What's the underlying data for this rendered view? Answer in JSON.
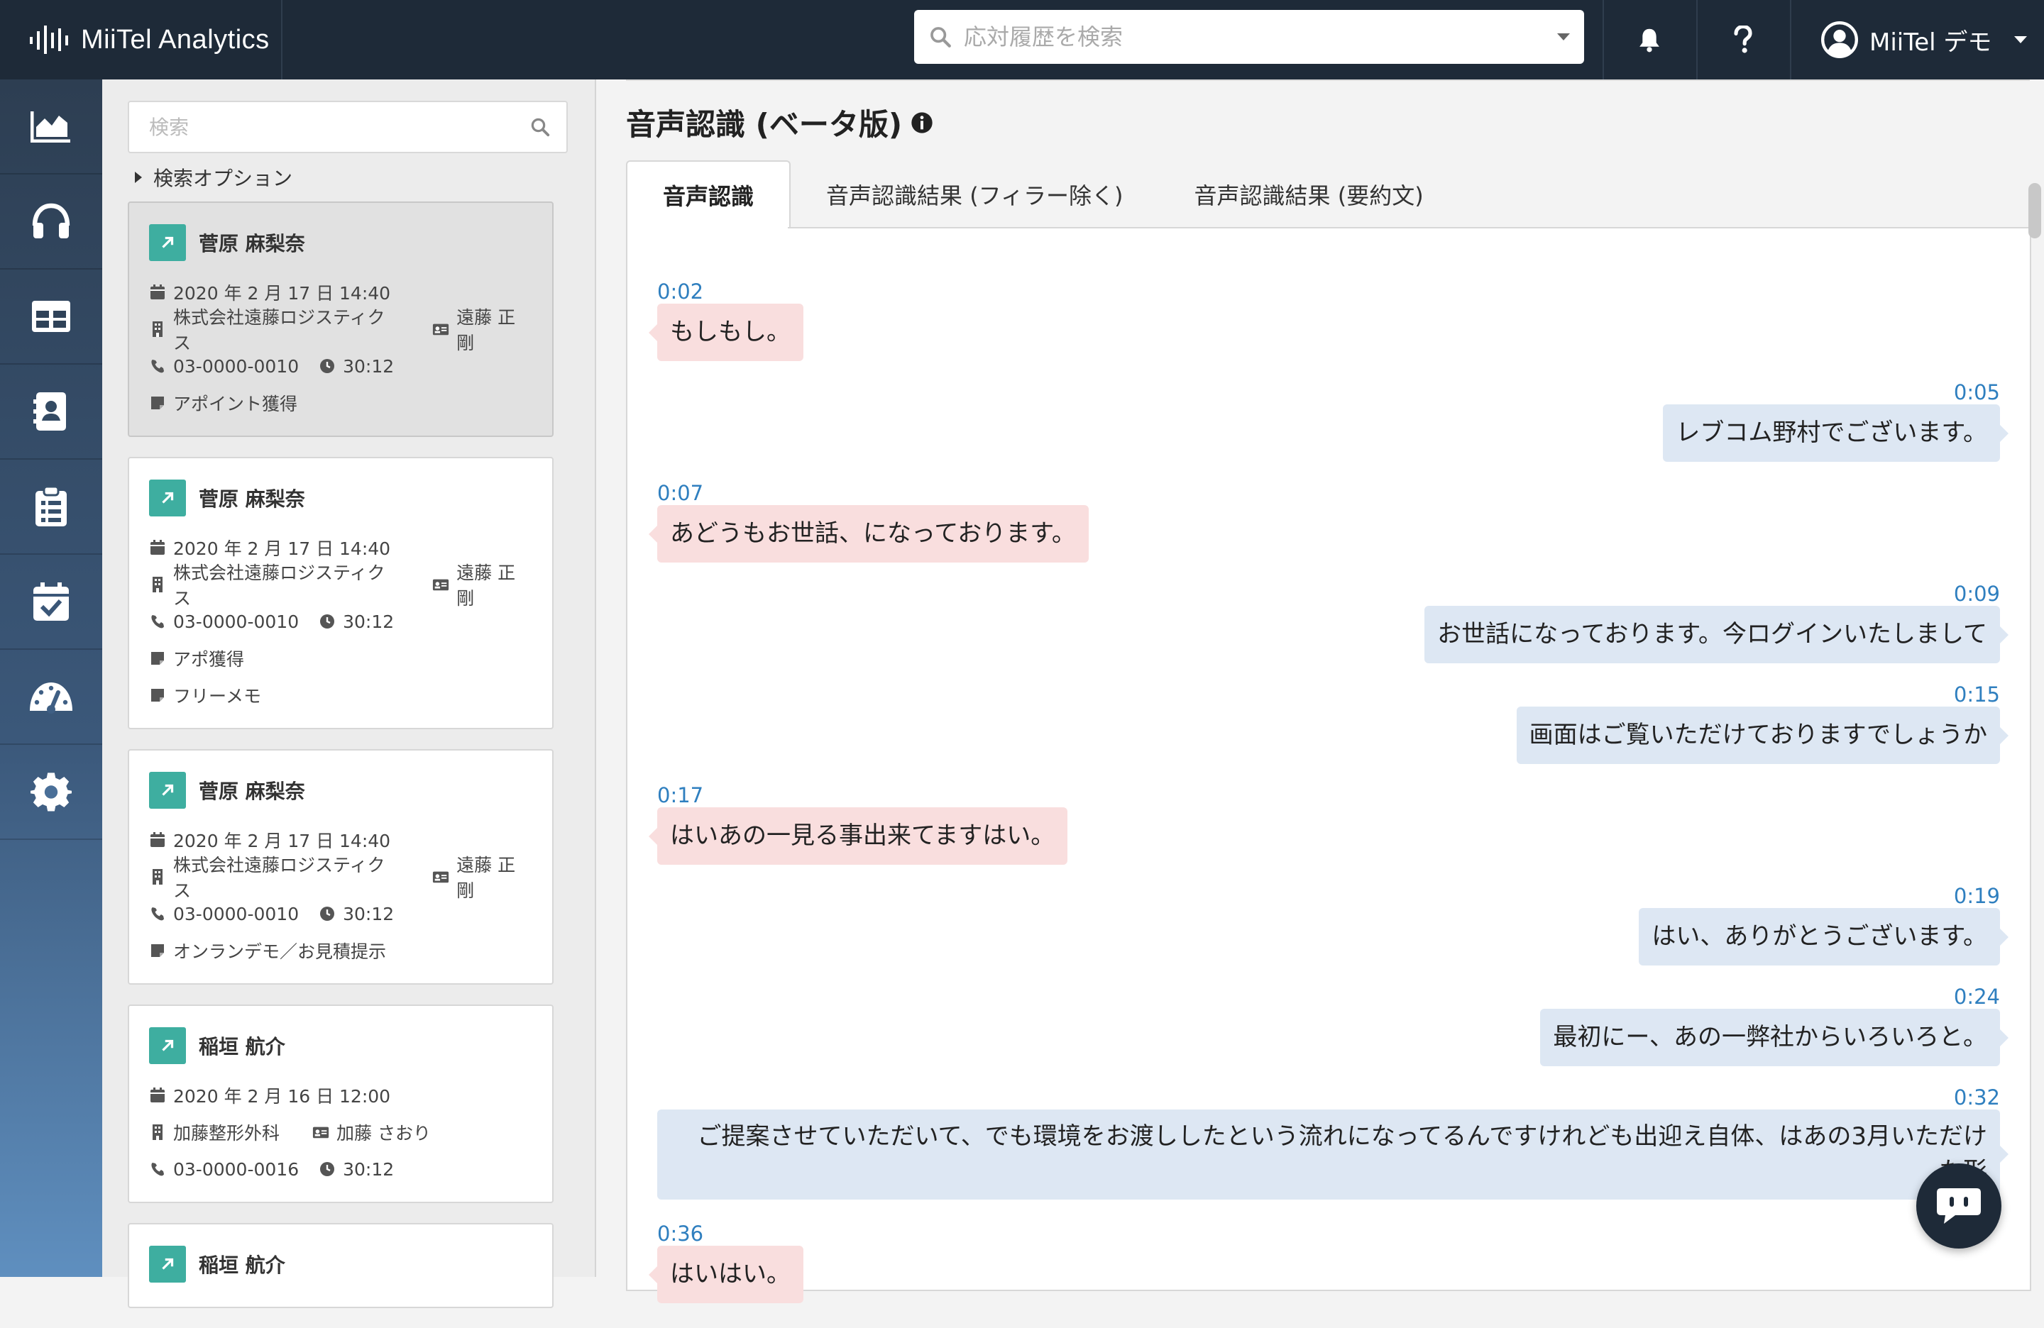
{
  "header": {
    "brand": "MiiTel Analytics",
    "search_placeholder": "応対履歴を検索",
    "user_name": "MiiTel デモ"
  },
  "nav": {
    "items": [
      "chart-icon",
      "headset-icon",
      "table-icon",
      "contact-card-icon",
      "clipboard-list-icon",
      "calendar-check-icon",
      "speedometer-icon",
      "gear-icon"
    ]
  },
  "sidebar": {
    "search_placeholder": "検索",
    "search_options_label": "検索オプション",
    "cards": [
      {
        "name": "菅原 麻梨奈",
        "datetime": "2020 年 2 月 17 日 14:40",
        "company": "株式会社遠藤ロジスティクス",
        "contact": "遠藤 正剛",
        "phone": "03-0000-0010",
        "duration": "30:12",
        "notes": [
          "アポイント獲得"
        ],
        "selected": true
      },
      {
        "name": "菅原 麻梨奈",
        "datetime": "2020 年 2 月 17 日 14:40",
        "company": "株式会社遠藤ロジスティクス",
        "contact": "遠藤 正剛",
        "phone": "03-0000-0010",
        "duration": "30:12",
        "notes": [
          "アポ獲得",
          "フリーメモ"
        ],
        "selected": false
      },
      {
        "name": "菅原 麻梨奈",
        "datetime": "2020 年 2 月 17 日 14:40",
        "company": "株式会社遠藤ロジスティクス",
        "contact": "遠藤 正剛",
        "phone": "03-0000-0010",
        "duration": "30:12",
        "notes": [
          "オンランデモ／お見積提示"
        ],
        "selected": false
      },
      {
        "name": "稲垣 航介",
        "datetime": "2020 年 2 月 16 日 12:00",
        "company": "加藤整形外科",
        "contact": "加藤 さおり",
        "phone": "03-0000-0016",
        "duration": "30:12",
        "notes": [],
        "selected": false
      },
      {
        "name": "稲垣 航介"
      }
    ]
  },
  "main": {
    "title": "音声認識 (ベータ版)",
    "tabs": [
      "音声認識",
      "音声認識結果 (フィラー除く)",
      "音声認識結果 (要約文)"
    ],
    "messages": [
      {
        "time": "0:02",
        "side": "left",
        "text": "もしもし。"
      },
      {
        "time": "0:05",
        "side": "right",
        "text": "レブコム野村でございます。"
      },
      {
        "time": "0:07",
        "side": "left",
        "text": "あどうもお世話、になっております。"
      },
      {
        "time": "0:09",
        "side": "right",
        "text": "お世話になっております。今ログインいたしまして"
      },
      {
        "time": "0:15",
        "side": "right",
        "text": "画面はご覧いただけておりますでしょうか"
      },
      {
        "time": "0:17",
        "side": "left",
        "text": "はいあの一見る事出来てますはい。"
      },
      {
        "time": "0:19",
        "side": "right",
        "text": "はい、ありがとうございます。"
      },
      {
        "time": "0:24",
        "side": "right",
        "text": "最初にー、あの一弊社からいろいろと。"
      },
      {
        "time": "0:32",
        "side": "right",
        "text": "ご提案させていただいて、でも環境をお渡ししたという流れになってるんですけれども出迎え自体、はあの3月いただけた形"
      },
      {
        "time": "0:36",
        "side": "left",
        "text": "はいはい。"
      }
    ]
  }
}
